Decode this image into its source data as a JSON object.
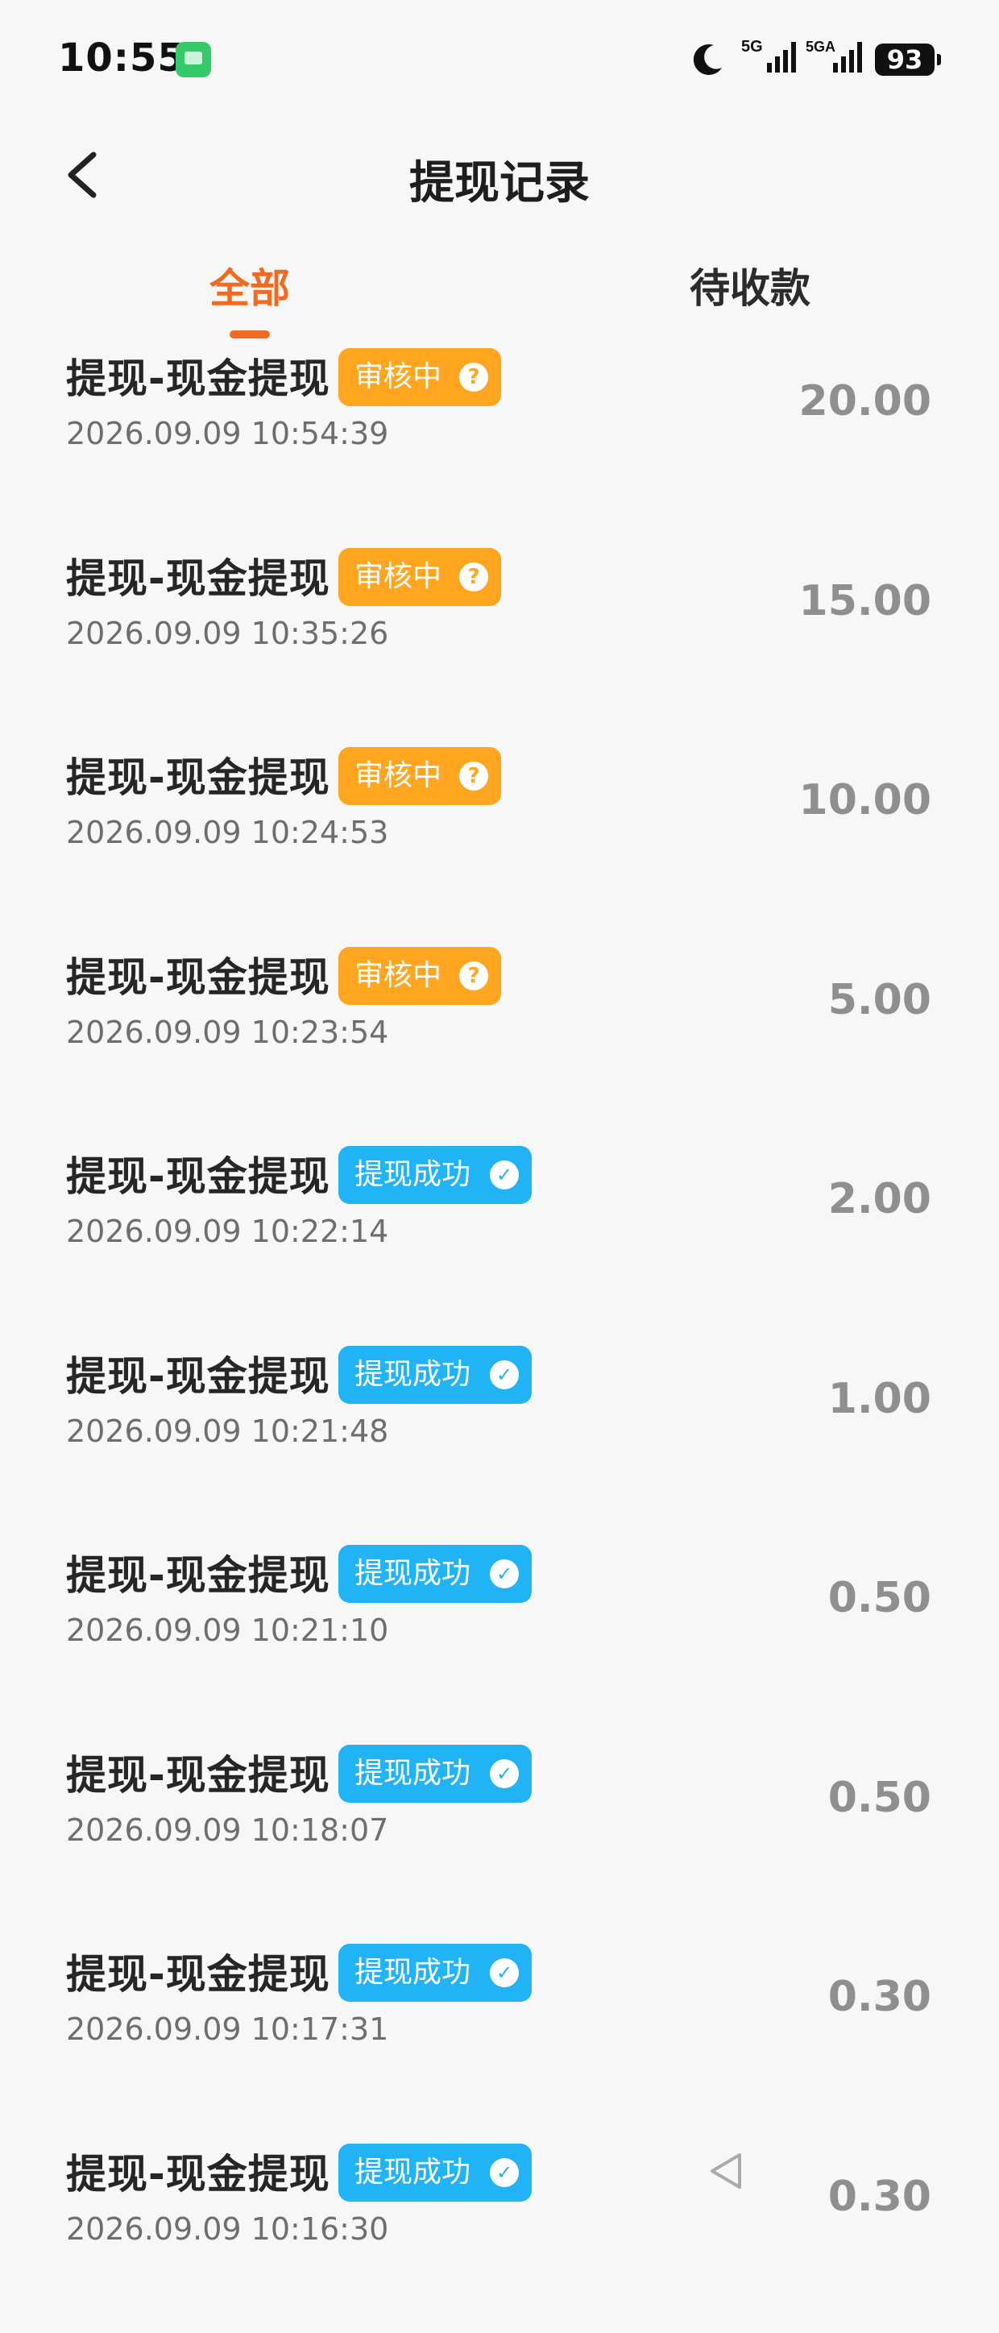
{
  "status_bar": {
    "time": "10:55",
    "battery": "93",
    "signal_labels": [
      "5G",
      "5GA"
    ]
  },
  "header": {
    "title": "提现记录"
  },
  "tabs": [
    {
      "label": "全部",
      "active": true
    },
    {
      "label": "待收款",
      "active": false
    }
  ],
  "records": [
    {
      "title": "提现-现金提现",
      "status": "审核中",
      "status_type": "pending",
      "time": "2026.09.09 10:54:39",
      "amount": "20.00"
    },
    {
      "title": "提现-现金提现",
      "status": "审核中",
      "status_type": "pending",
      "time": "2026.09.09 10:35:26",
      "amount": "15.00"
    },
    {
      "title": "提现-现金提现",
      "status": "审核中",
      "status_type": "pending",
      "time": "2026.09.09 10:24:53",
      "amount": "10.00"
    },
    {
      "title": "提现-现金提现",
      "status": "审核中",
      "status_type": "pending",
      "time": "2026.09.09 10:23:54",
      "amount": "5.00"
    },
    {
      "title": "提现-现金提现",
      "status": "提现成功",
      "status_type": "success",
      "time": "2026.09.09 10:22:14",
      "amount": "2.00"
    },
    {
      "title": "提现-现金提现",
      "status": "提现成功",
      "status_type": "success",
      "time": "2026.09.09 10:21:48",
      "amount": "1.00"
    },
    {
      "title": "提现-现金提现",
      "status": "提现成功",
      "status_type": "success",
      "time": "2026.09.09 10:21:10",
      "amount": "0.50"
    },
    {
      "title": "提现-现金提现",
      "status": "提现成功",
      "status_type": "success",
      "time": "2026.09.09 10:18:07",
      "amount": "0.50"
    },
    {
      "title": "提现-现金提现",
      "status": "提现成功",
      "status_type": "success",
      "time": "2026.09.09 10:17:31",
      "amount": "0.30"
    },
    {
      "title": "提现-现金提现",
      "status": "提现成功",
      "status_type": "success",
      "time": "2026.09.09 10:16:30",
      "amount": "0.30"
    }
  ],
  "icons": {
    "pending_badge": "question-icon",
    "success_badge": "wechat-icon",
    "back": "chevron-left-icon",
    "nav_back": "triangle-back-icon"
  },
  "colors": {
    "accent": "#f06a22",
    "pending": "#ffa51f",
    "success": "#22b2f6",
    "amount": "#8f8f8f"
  }
}
